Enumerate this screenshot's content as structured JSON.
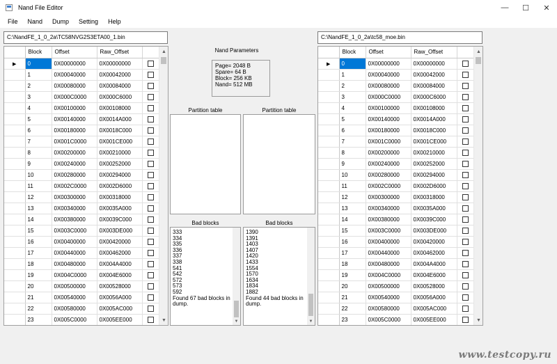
{
  "window": {
    "title": "Nand File Editor",
    "minimize": "—",
    "maximize": "☐",
    "close": "✕"
  },
  "menu": [
    "File",
    "Nand",
    "Dump",
    "Setting",
    "Help"
  ],
  "left": {
    "path": "C:\\NandFE_1_0_2a\\TC58NVG2S3ETA00_1.bin",
    "columns": [
      "Block",
      "Offset",
      "Raw_Offset"
    ],
    "rows": [
      [
        "0",
        "0X00000000",
        "0X00000000"
      ],
      [
        "1",
        "0X00040000",
        "0X00042000"
      ],
      [
        "2",
        "0X00080000",
        "0X00084000"
      ],
      [
        "3",
        "0X000C0000",
        "0X000C6000"
      ],
      [
        "4",
        "0X00100000",
        "0X00108000"
      ],
      [
        "5",
        "0X00140000",
        "0X0014A000"
      ],
      [
        "6",
        "0X00180000",
        "0X0018C000"
      ],
      [
        "7",
        "0X001C0000",
        "0X001CE000"
      ],
      [
        "8",
        "0X00200000",
        "0X00210000"
      ],
      [
        "9",
        "0X00240000",
        "0X00252000"
      ],
      [
        "10",
        "0X00280000",
        "0X00294000"
      ],
      [
        "11",
        "0X002C0000",
        "0X002D6000"
      ],
      [
        "12",
        "0X00300000",
        "0X00318000"
      ],
      [
        "13",
        "0X00340000",
        "0X0035A000"
      ],
      [
        "14",
        "0X00380000",
        "0X0039C000"
      ],
      [
        "15",
        "0X003C0000",
        "0X003DE000"
      ],
      [
        "16",
        "0X00400000",
        "0X00420000"
      ],
      [
        "17",
        "0X00440000",
        "0X00462000"
      ],
      [
        "18",
        "0X00480000",
        "0X004A4000"
      ],
      [
        "19",
        "0X004C0000",
        "0X004E6000"
      ],
      [
        "20",
        "0X00500000",
        "0X00528000"
      ],
      [
        "21",
        "0X00540000",
        "0X0056A000"
      ],
      [
        "22",
        "0X00580000",
        "0X005AC000"
      ],
      [
        "23",
        "0X005C0000",
        "0X005EE000"
      ]
    ]
  },
  "right": {
    "path": "C:\\NandFE_1_0_2a\\tc58_moe.bin",
    "columns": [
      "Block",
      "Offset",
      "Raw_Offset"
    ],
    "rows": [
      [
        "0",
        "0X00000000",
        "0X00000000"
      ],
      [
        "1",
        "0X00040000",
        "0X00042000"
      ],
      [
        "2",
        "0X00080000",
        "0X00084000"
      ],
      [
        "3",
        "0X000C0000",
        "0X000C6000"
      ],
      [
        "4",
        "0X00100000",
        "0X00108000"
      ],
      [
        "5",
        "0X00140000",
        "0X0014A000"
      ],
      [
        "6",
        "0X00180000",
        "0X0018C000"
      ],
      [
        "7",
        "0X001C0000",
        "0X001CE000"
      ],
      [
        "8",
        "0X00200000",
        "0X00210000"
      ],
      [
        "9",
        "0X00240000",
        "0X00252000"
      ],
      [
        "10",
        "0X00280000",
        "0X00294000"
      ],
      [
        "11",
        "0X002C0000",
        "0X002D6000"
      ],
      [
        "12",
        "0X00300000",
        "0X00318000"
      ],
      [
        "13",
        "0X00340000",
        "0X0035A000"
      ],
      [
        "14",
        "0X00380000",
        "0X0039C000"
      ],
      [
        "15",
        "0X003C0000",
        "0X003DE000"
      ],
      [
        "16",
        "0X00400000",
        "0X00420000"
      ],
      [
        "17",
        "0X00440000",
        "0X00462000"
      ],
      [
        "18",
        "0X00480000",
        "0X004A4000"
      ],
      [
        "19",
        "0X004C0000",
        "0X004E6000"
      ],
      [
        "20",
        "0X00500000",
        "0X00528000"
      ],
      [
        "21",
        "0X00540000",
        "0X0056A000"
      ],
      [
        "22",
        "0X00580000",
        "0X005AC000"
      ],
      [
        "23",
        "0X005C0000",
        "0X005EE000"
      ]
    ]
  },
  "center": {
    "params_title": "Nand Parameters",
    "params": [
      "Page= 2048 B",
      "Spare= 64 B",
      "Block= 256 KB",
      "Nand= 512 MB"
    ],
    "partition_left_title": "Partition table",
    "partition_right_title": "Partition table",
    "bad_left_title": "Bad blocks",
    "bad_right_title": "Bad blocks",
    "bad_left": [
      "333",
      "334",
      "335",
      "336",
      "337",
      "338",
      "541",
      "542",
      "572",
      "573",
      "592",
      "Found 67 bad blocks in",
      "dump."
    ],
    "bad_right": [
      "1390",
      "1391",
      "1403",
      "1407",
      "1420",
      "1433",
      "1554",
      "1570",
      "1634",
      "1834",
      "1882",
      "Found 44 bad blocks in",
      "dump."
    ]
  },
  "icons": {
    "current_row": "row-pointer-icon",
    "scroll_up": "arrow-up-icon",
    "scroll_down": "arrow-down-icon"
  },
  "colors": {
    "selection": "#0078d7",
    "background": "#f0f0f0"
  },
  "watermark": "www.testcopy.ru"
}
